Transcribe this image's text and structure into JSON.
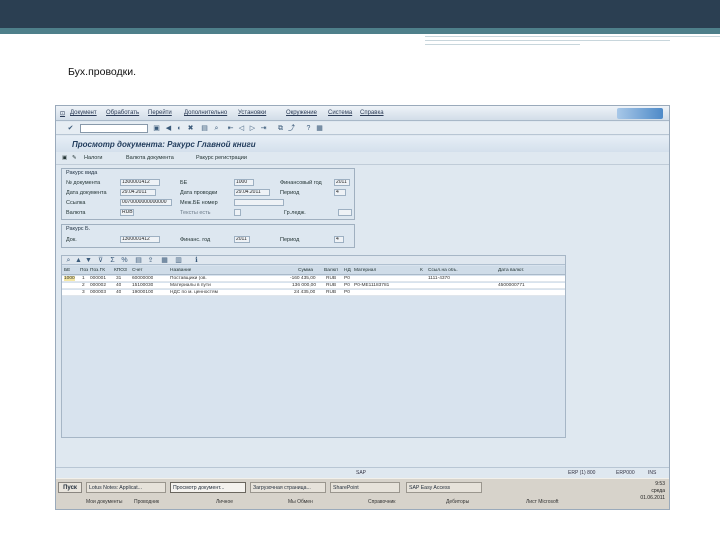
{
  "slide": {
    "title": "Бух.проводки."
  },
  "sap": {
    "menu": [
      "Документ",
      "Обработать",
      "Перейти",
      "Дополнительно",
      "Установки",
      "Окружение",
      "Система",
      "Справка"
    ],
    "title": "Просмотр документа: Ракурс Главной книги",
    "app_toolbar": [
      "Налоги",
      "Валюта документа",
      "Ракурс регистрации"
    ],
    "group1": {
      "title": "Ракурс вида",
      "doc_label": "№ документа",
      "doc_value": "1300001412",
      "be_label": "БЕ",
      "be_value": "1000",
      "fy_label": "Финансовый год",
      "fy_value": "2011",
      "docdate_label": "Дата документа",
      "docdate_value": "29.04.2011",
      "postdate_label": "Дата проводки",
      "postdate_value": "29.04.2011",
      "period_label": "Период",
      "period_value": "4",
      "ref_label": "Ссылка",
      "ref_value": "0070000000000000",
      "crossco_label": "Меж.БЕ номер",
      "cur_label": "Валюта",
      "cur_value": "RUB",
      "text_label": "Тексты есть",
      "ledger_label": "Гр.ледж."
    },
    "group2": {
      "title": "Ракурс Б.",
      "doc_label": "Док.",
      "doc_value": "1300001412",
      "fy_label": "Финанс. год",
      "fy_value": "2011",
      "period_label": "Период",
      "period_value": "4"
    },
    "grid": {
      "headers": [
        "БЕ",
        "Поз",
        "Поз.ГК",
        "КПОЗ",
        "Счет",
        "Название",
        "Сумма",
        "Валют",
        "НД",
        "Материал",
        "К",
        "Ссыл.на объ.",
        "Дата валют."
      ],
      "rows": [
        [
          "1000",
          "1",
          "000001",
          "31",
          "60000000",
          "Поставщики (ов.",
          "-160 435,00",
          "RUB",
          "Р0",
          "",
          "",
          "1111-4370",
          ""
        ],
        [
          "",
          "2",
          "000002",
          "40",
          "15100030",
          "Материалы в пути",
          "136 000,00",
          "RUB",
          "Р0",
          "Р0-МЕ11183781",
          "",
          "",
          "4500000771"
        ],
        [
          "",
          "3",
          "000003",
          "40",
          "19000100",
          "НДС по м. ценностям",
          "24 435,00",
          "RUB",
          "Р0",
          "",
          "",
          "",
          ""
        ]
      ]
    },
    "status": {
      "left": "SAP",
      "sys": "ERP (1) 800",
      "client": "ERP000",
      "mode": "INS"
    },
    "taskbar": {
      "start": "Пуск",
      "tasks": [
        "Lotus Notes: Applicat...",
        "Просмотр документ...",
        "Загрузочная страница...",
        "SharePoint",
        "SAP Easy Access"
      ],
      "tasks2": [
        "Мои документы",
        "Проводник",
        "Личное",
        "Мы Обмен",
        "Справочник",
        "Дебиторы",
        "Лист Microsoft"
      ],
      "clock_time": "9:53",
      "clock_day": "среда",
      "clock_date": "01.06.2011"
    }
  }
}
